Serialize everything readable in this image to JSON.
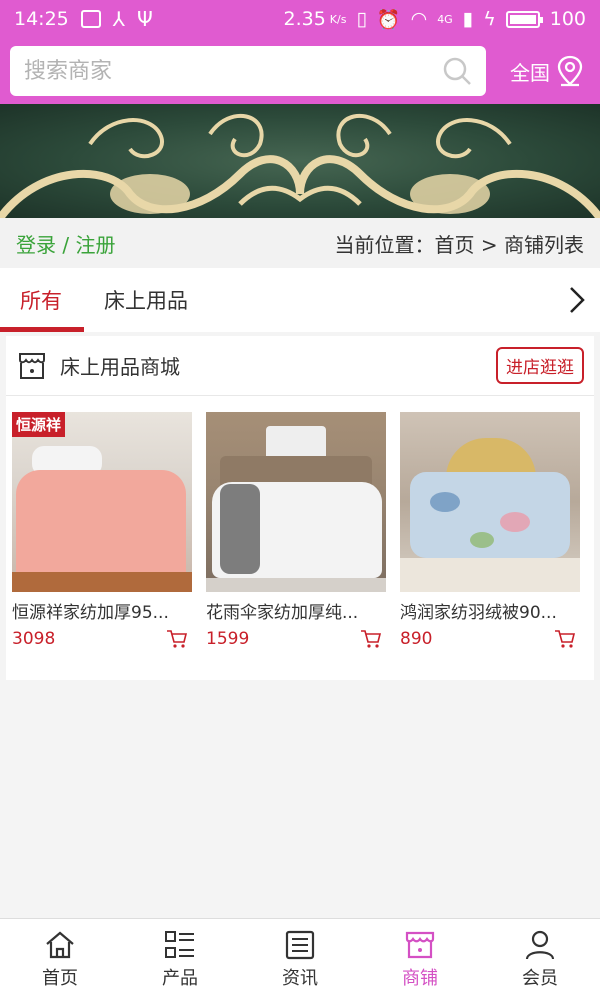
{
  "status_bar": {
    "time": "14:25",
    "speed": "2.35",
    "speed_unit": "K/s",
    "signal_label": "4G",
    "battery": "100"
  },
  "header": {
    "search_placeholder": "搜索商家",
    "region_label": "全国"
  },
  "breadcrumb": {
    "login_register": "登录 / 注册",
    "current_position": "当前位置：首页 > 商铺列表"
  },
  "tabs": [
    {
      "label": "所有",
      "active": true
    },
    {
      "label": "床上用品",
      "active": false
    }
  ],
  "store": {
    "name": "床上用品商城",
    "visit_button": "进店逛逛",
    "products": [
      {
        "name": "恒源祥家纺加厚95...",
        "price": "3098",
        "brand_tag": "恒源祥"
      },
      {
        "name": "花雨伞家纺加厚纯...",
        "price": "1599"
      },
      {
        "name": "鸿润家纺羽绒被90...",
        "price": "890"
      }
    ]
  },
  "bottom_nav": [
    {
      "label": "首页",
      "icon": "home-icon",
      "active": false
    },
    {
      "label": "产品",
      "icon": "list-icon",
      "active": false
    },
    {
      "label": "资讯",
      "icon": "news-icon",
      "active": false
    },
    {
      "label": "商铺",
      "icon": "shop-icon",
      "active": true
    },
    {
      "label": "会员",
      "icon": "user-icon",
      "active": false
    }
  ],
  "colors": {
    "brand": "#e05bd0",
    "accent_red": "#c8202a",
    "login_green": "#3aa33a"
  }
}
